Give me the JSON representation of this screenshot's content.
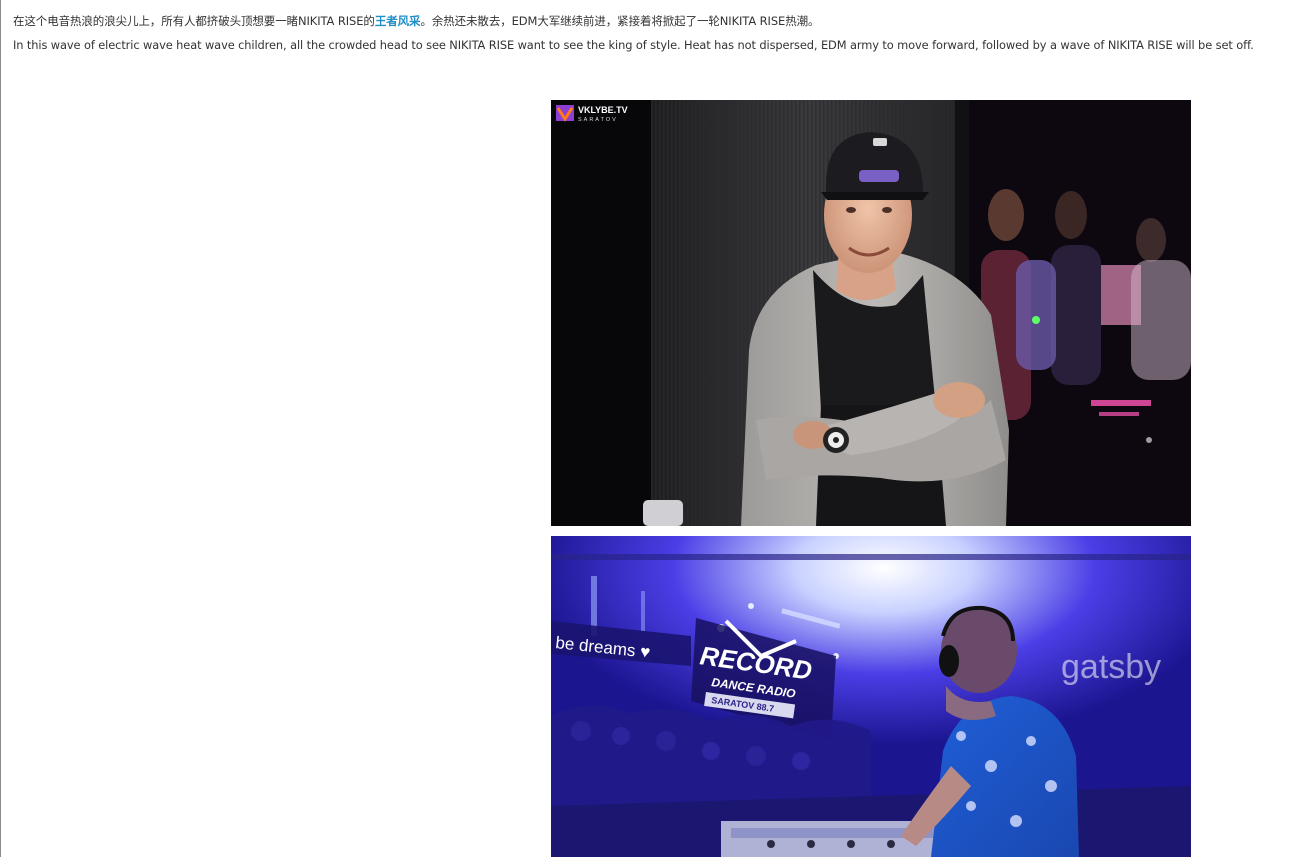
{
  "article": {
    "paragraph_zh": {
      "before": "在这个电音热浪的浪尖儿上，所有人都挤破头顶想要一睹NIKITA RISE的",
      "highlight": "王者风采",
      "after": "。余热还未散去，EDM大军继续前进，紧接着将掀起了一轮NIKITA RISE热潮。"
    },
    "paragraph_en": "In this wave of electric wave heat wave children, all the crowded head to see NIKITA RISE want to see the king of style. Heat has not dispersed, EDM army to move forward, followed by a wave of NIKITA RISE will be set off.",
    "accent_color": "#1f8fc6"
  },
  "photos": [
    {
      "watermark": "VKLYBE.TV",
      "watermark_sub": "SARATOV"
    },
    {
      "sign_lines": [
        "RECORD",
        "DANCE RADIO",
        "SARATOV 88.7"
      ],
      "banner_text": "be dreams ♥",
      "wall_text": "gatsby"
    }
  ]
}
